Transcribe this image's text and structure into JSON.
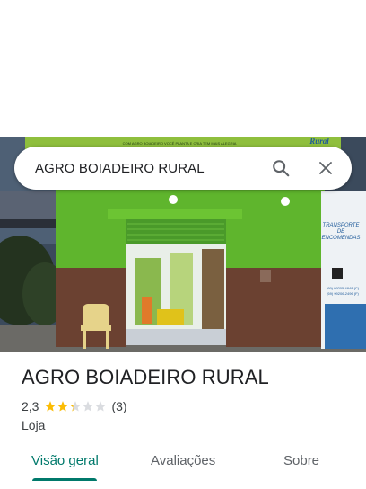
{
  "search": {
    "query": "AGRO BOIADEIRO RURAL"
  },
  "place": {
    "name": "AGRO BOIADEIRO RURAL",
    "rating": "2,3",
    "rating_value": 2.3,
    "rating_max": 5,
    "review_count": "(3)",
    "category": "Loja"
  },
  "photo": {
    "sign_top": "COM AGRO BOIADEIRO VOCÊ PLANTA E CRIA TEM MAIS ALEGRIA",
    "sign_brand": "Rural",
    "side_sign": [
      "TRANSPORTE",
      "DE",
      "ENCOMENDAS"
    ],
    "phones": [
      "(69) 99205-4848 (C)",
      "(69) 99206-2496 (F)"
    ]
  },
  "tabs": [
    {
      "label": "Visão geral",
      "active": true
    },
    {
      "label": "Avaliações",
      "active": false
    },
    {
      "label": "Sobre",
      "active": false
    }
  ],
  "colors": {
    "accent": "#00796b",
    "star": "#fbbc04",
    "star_empty": "#dadce0"
  },
  "icons": {
    "search": "search-icon",
    "close": "close-icon",
    "star": "star-icon"
  }
}
